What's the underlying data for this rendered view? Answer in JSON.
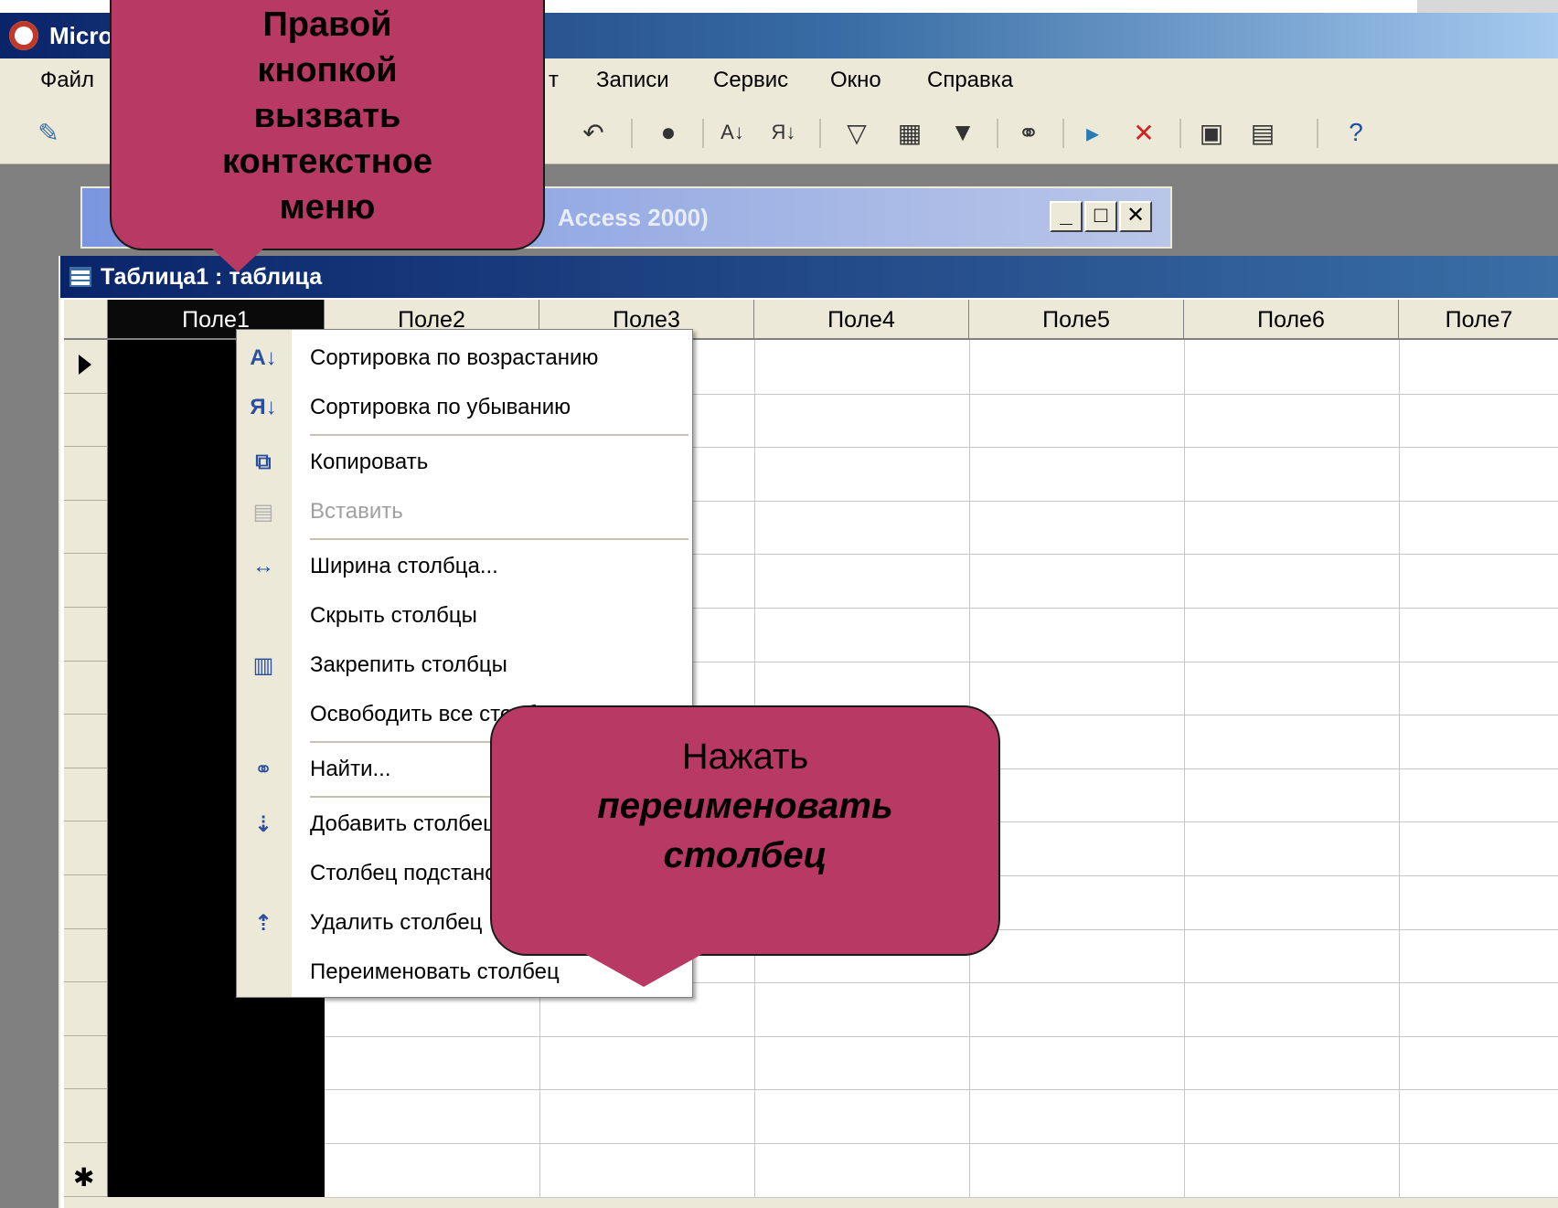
{
  "app": {
    "title": "Micro",
    "colors": {
      "titlebar": "#0a246a",
      "callout": "#b83a64",
      "menu_bg": "#ece9d8"
    }
  },
  "menubar": {
    "items": [
      {
        "label": "Файл"
      },
      {
        "label": "т"
      },
      {
        "label": "Записи"
      },
      {
        "label": "Сервис"
      },
      {
        "label": "Окно"
      },
      {
        "label": "Справка"
      }
    ]
  },
  "toolbar": {
    "icons": [
      "design-view-icon",
      "undo-icon",
      "find-icon",
      "sort-asc-icon",
      "sort-desc-icon",
      "filter-selection-icon",
      "filter-form-icon",
      "apply-filter-icon",
      "binoculars-icon",
      "new-record-icon",
      "delete-record-icon",
      "database-window-icon",
      "new-object-icon",
      "help-icon"
    ]
  },
  "db_window": {
    "title": "Access 2000)"
  },
  "table_window": {
    "title": "Таблица1 : таблица",
    "columns": [
      "Поле1",
      "Поле2",
      "Поле3",
      "Поле4",
      "Поле5",
      "Поле6",
      "Поле7"
    ],
    "selected_column": "Поле1",
    "new_row_marker": "✱"
  },
  "context_menu": {
    "items": [
      {
        "label": "Сортировка по возрастанию",
        "icon": "sort-asc-icon",
        "enabled": true
      },
      {
        "label": "Сортировка по убыванию",
        "icon": "sort-desc-icon",
        "enabled": true
      },
      {
        "label": "Копировать",
        "icon": "copy-icon",
        "enabled": true
      },
      {
        "label": "Вставить",
        "icon": "paste-icon",
        "enabled": false
      },
      {
        "label": "Ширина столбца...",
        "icon": "column-width-icon",
        "enabled": true
      },
      {
        "label": "Скрыть столбцы",
        "icon": "",
        "enabled": true
      },
      {
        "label": "Закрепить столбцы",
        "icon": "freeze-columns-icon",
        "enabled": true
      },
      {
        "label": "Освободить все столбцы",
        "icon": "",
        "enabled": true
      },
      {
        "label": "Найти...",
        "icon": "binoculars-icon",
        "enabled": true
      },
      {
        "label": "Добавить столбец",
        "icon": "insert-column-icon",
        "enabled": true
      },
      {
        "label": "Столбец подстановок...",
        "icon": "",
        "enabled": true
      },
      {
        "label": "Удалить столбец",
        "icon": "delete-column-icon",
        "enabled": true
      },
      {
        "label": "Переименовать столбец",
        "icon": "",
        "enabled": true
      }
    ]
  },
  "callouts": {
    "first": {
      "lines": [
        "Правой",
        "кнопкой",
        "вызвать",
        "контекстное",
        "меню"
      ]
    },
    "second": {
      "line1": "Нажать",
      "line2": "переименовать",
      "line3": "столбец"
    }
  }
}
